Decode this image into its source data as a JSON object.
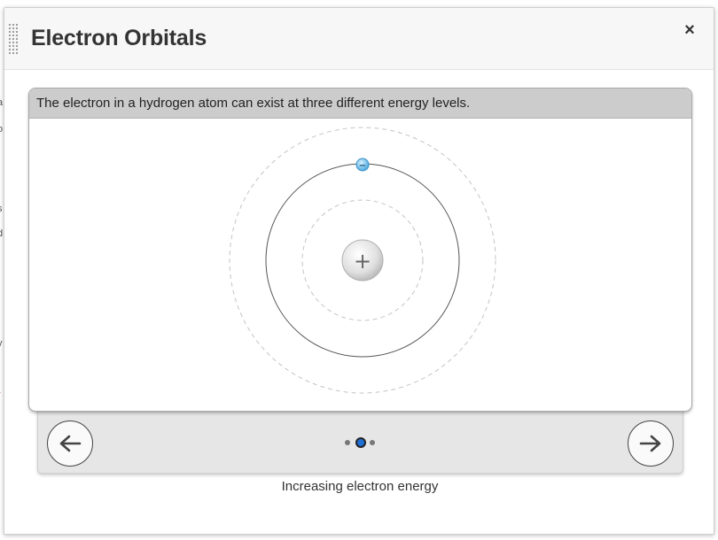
{
  "dialog": {
    "title": "Electron Orbitals",
    "close_label": "×"
  },
  "viewer": {
    "caption": "The electron in a hydrogen atom can exist at three different energy levels.",
    "nucleus_symbol": "+",
    "electron_symbol": "−",
    "orbitals": [
      {
        "level": 1,
        "active": false
      },
      {
        "level": 2,
        "active": true
      },
      {
        "level": 3,
        "active": false
      }
    ],
    "electron_level": 2
  },
  "navigation": {
    "current_step": 2,
    "total_steps": 3,
    "prev_icon": "arrow-left-icon",
    "next_icon": "arrow-right-icon"
  },
  "footer": {
    "caption": "Increasing electron energy"
  },
  "colors": {
    "header_bg": "#f7f7f7",
    "caption_bar_bg": "#cccccc",
    "nav_panel_bg": "#e6e6e6",
    "active_dot": "#1f6fd6",
    "electron": "#5ab8ec"
  }
}
